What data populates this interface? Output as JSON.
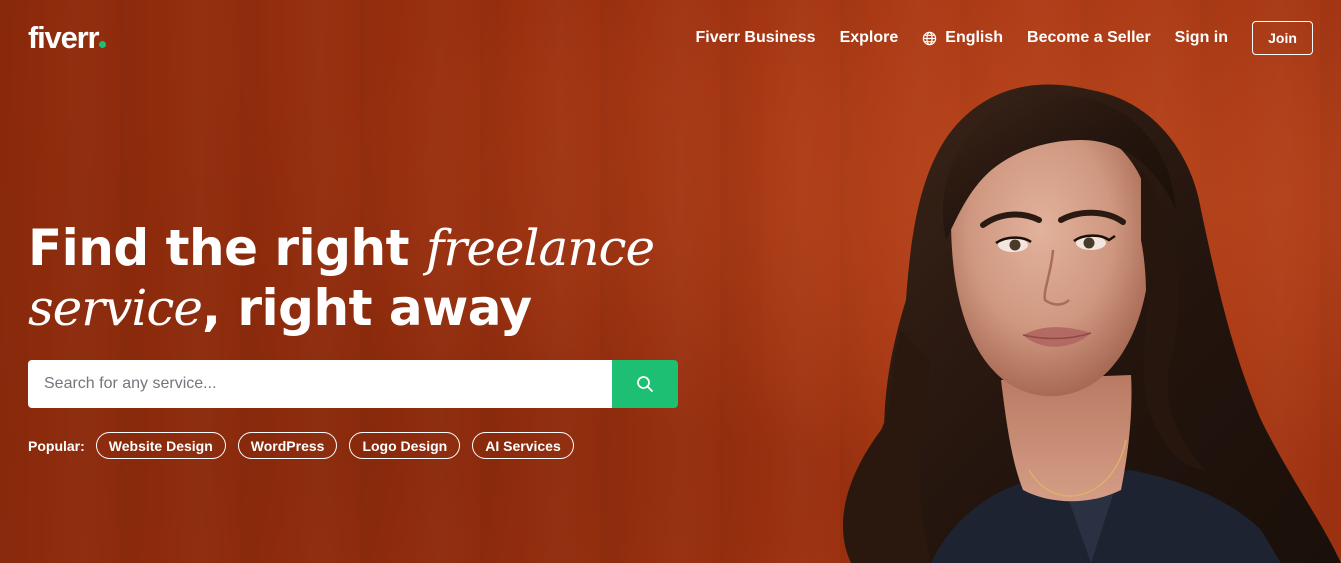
{
  "header": {
    "logo_text": "fiverr",
    "nav": {
      "business": "Fiverr Business",
      "explore": "Explore",
      "language": "English",
      "become_seller": "Become a Seller",
      "sign_in": "Sign in",
      "join": "Join"
    }
  },
  "hero": {
    "headline": {
      "part1": "Find the right ",
      "italic1": "freelance",
      "italic2": "service",
      "part2": ", right away"
    },
    "search": {
      "placeholder": "Search for any service..."
    },
    "popular": {
      "label": "Popular:",
      "tags": [
        "Website Design",
        "WordPress",
        "Logo Design",
        "AI Services"
      ]
    }
  },
  "colors": {
    "brand_green": "#1dbf73",
    "hero_background": "#9b300f",
    "text_white": "#ffffff"
  },
  "icons": {
    "language": "globe-icon",
    "search": "search-icon"
  }
}
